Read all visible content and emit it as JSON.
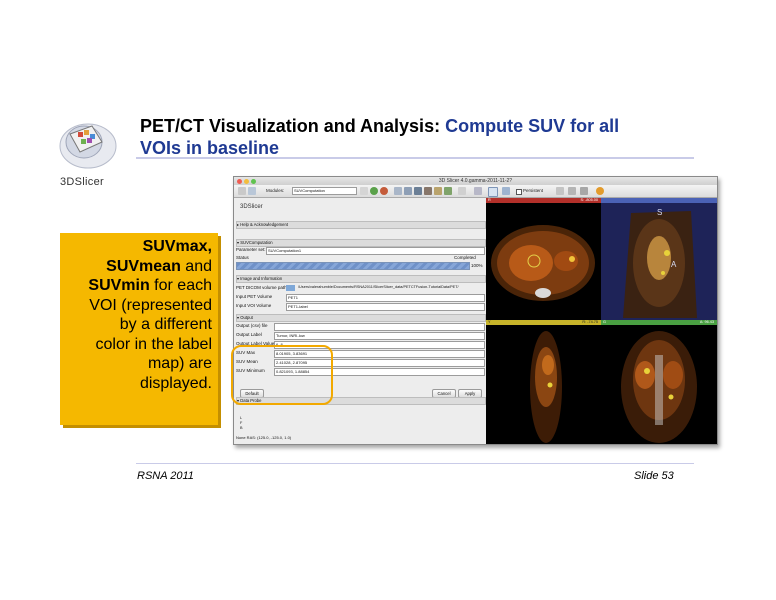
{
  "logo": {
    "text": "3DSlicer"
  },
  "title": {
    "part1": "PET/CT Visualization and Analysis:",
    "part2": "Compute SUV for all",
    "part3": "VOIs in baseline"
  },
  "callout": {
    "l1": "SUVmax,",
    "l2b": "SUVmean",
    "l2": " and",
    "l3b": "SUVmin",
    "l3": " for each",
    "l4": "VOI (represented",
    "l5": "by a different",
    "l6": "color in the label",
    "l7": "map) are",
    "l8": "displayed."
  },
  "app": {
    "window_title": "3D Slicer 4.0.gamma-2011-11-2?",
    "toolbar": {
      "modules_label": "Modules:",
      "module_value": "SUVComputation",
      "persistent_label": "Persistent"
    },
    "panel": {
      "brand": "3DSlicer",
      "help_section": "Help & Acknowledgement",
      "suv_section": "SUVComputation",
      "param_set_label": "Parameter set:",
      "param_set_value": "SUVComputation1",
      "status_label": "Status",
      "status_value": "Completed",
      "progress_value": "100%",
      "progress_fraction": 1.0,
      "image_info_section": "Image and Information",
      "dicom_path_label": "PET DICOM volume path:",
      "dicom_path_value": "/Users/valerahumble/Documents/RSNA2011/SlicerSlicer_data/PETCTFusion-TutorialData/PET/",
      "input_pet_label": "Input PET Volume",
      "input_pet_value": "PET1",
      "input_voi_label": "Input VOI Volume",
      "input_voi_value": "PET1-label",
      "output_section": "Output",
      "output_csv_label": "Output (csv) file",
      "output_csv_value": "",
      "output_label_label": "Output Label",
      "output_label_value": "Tumor, INRI-low",
      "output_label_value_label": "Output Label Value",
      "output_label_value_value": "6, 8",
      "suv_max_label": "SUV Max",
      "suv_max_value": "8.01905, 3.83691",
      "suv_mean_label": "SUV Mean",
      "suv_mean_value": "2.41028, 2.87095",
      "suv_min_label": "SUV Minimum",
      "suv_min_value": "0.821093, 1.88854",
      "default_button": "Default",
      "cancel_button": "Cancel",
      "apply_button": "Apply",
      "data_probe_section": "Data Probe",
      "probe_l": "L",
      "probe_f": "F",
      "probe_b": "B",
      "status_bar": "None RAS: (125.0, -125.0, 1.0)"
    },
    "views": {
      "red_label": "R",
      "red_offset": "S: -805.00",
      "threeD_label": "S",
      "threeD_label_a": "A",
      "yellow_label": "Y",
      "yellow_offset": "R: -74.75",
      "green_label": "G",
      "green_offset": "A: 96.43"
    }
  },
  "footer": {
    "left": "RSNA 2011",
    "right": "Slide 53"
  },
  "colors": {
    "title_accent": "#1f3a93",
    "callout_bg": "#f5b800",
    "highlight": "#f2a900",
    "rule": "#c9cbe8"
  }
}
